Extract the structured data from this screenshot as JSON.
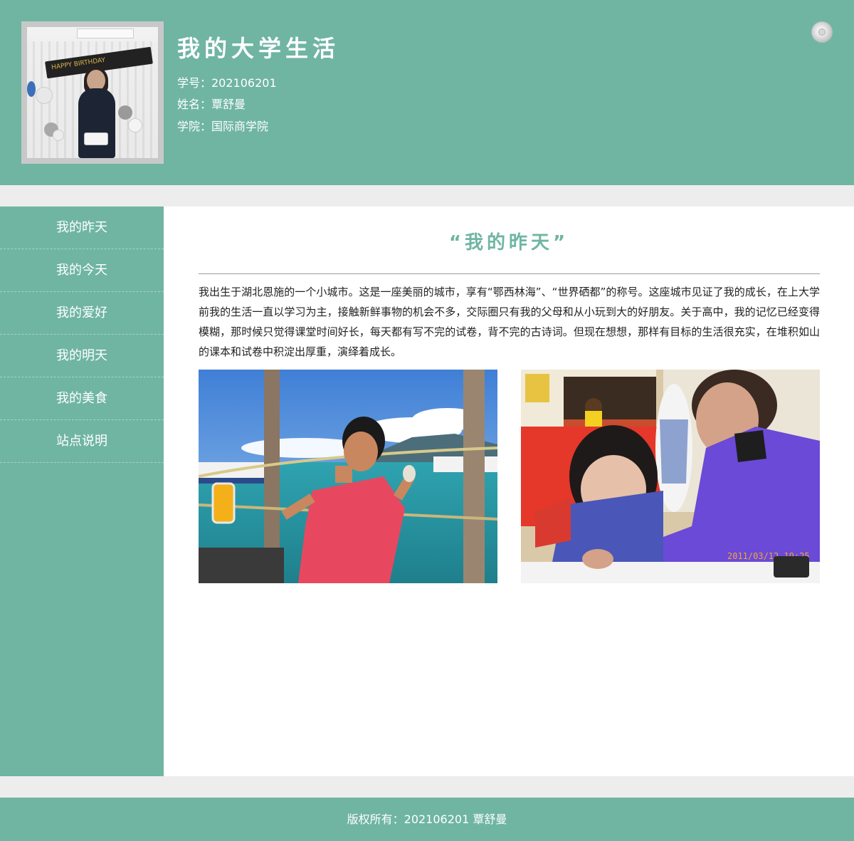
{
  "header": {
    "title": "我的大学生活",
    "student_id": "学号：202106201",
    "name": "姓名：覃舒曼",
    "college": "学院：国际商学院",
    "avatar_banner": "HAPPY BIRTHDAY",
    "top_button_icon": "circle-button-icon"
  },
  "sidebar": {
    "items": [
      {
        "label": "我的昨天"
      },
      {
        "label": "我的今天"
      },
      {
        "label": "我的爱好"
      },
      {
        "label": "我的明天"
      },
      {
        "label": "我的美食"
      },
      {
        "label": "站点说明"
      }
    ]
  },
  "main": {
    "title": "“我的昨天”",
    "paragraph": "我出生于湖北恩施的一个小城市。这是一座美丽的城市，享有“鄂西林海”、“世界硒都”的称号。这座城市见证了我的成长，在上大学前我的生活一直以学习为主，接触新鲜事物的机会不多，交际圈只有我的父母和从小玩到大的好朋友。关于高中，我的记忆已经变得模糊，那时候只觉得课堂时间好长，每天都有写不完的试卷，背不完的古诗词。但现在想想，那样有目标的生活很充实，在堆积如山的课本和试卷中积淀出厚重，演绎着成长。",
    "photo2_stamp": "2011/03/12 19:25"
  },
  "footer": {
    "text": "版权所有：202106201 覃舒曼"
  },
  "colors": {
    "accent": "#6fb5a2",
    "background": "#ededed",
    "content_bg": "#ffffff"
  }
}
